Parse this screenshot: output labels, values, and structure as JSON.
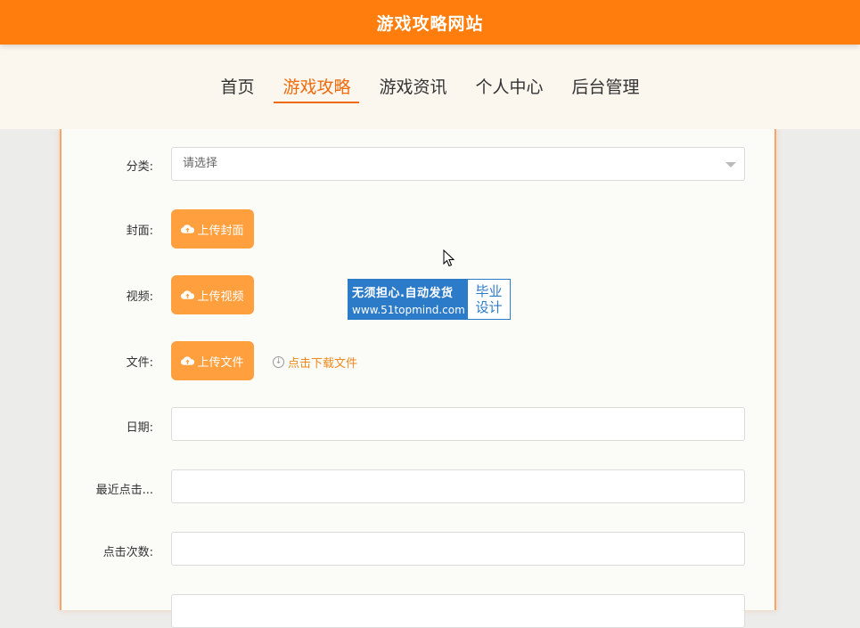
{
  "header": {
    "site_title": "游戏攻略网站"
  },
  "nav": {
    "items": [
      {
        "label": "首页",
        "active": false
      },
      {
        "label": "游戏攻略",
        "active": true
      },
      {
        "label": "游戏资讯",
        "active": false
      },
      {
        "label": "个人中心",
        "active": false
      },
      {
        "label": "后台管理",
        "active": false
      }
    ]
  },
  "form": {
    "category": {
      "label": "分类:",
      "placeholder": "请选择"
    },
    "cover": {
      "label": "封面:",
      "button": "上传封面"
    },
    "video": {
      "label": "视频:",
      "button": "上传视频"
    },
    "file": {
      "label": "文件:",
      "button": "上传文件",
      "download": "点击下载文件"
    },
    "date": {
      "label": "日期:",
      "value": ""
    },
    "last_click": {
      "label": "最近点击...",
      "value": ""
    },
    "click_count": {
      "label": "点击次数:",
      "value": ""
    }
  },
  "watermark": {
    "line1": "无须担心.自动发货",
    "line2": "www.51topmind.com",
    "badge_top": "毕业",
    "badge_bottom": "设计"
  },
  "colors": {
    "primary": "#ff7d0c",
    "button": "#ff9f3e",
    "accent": "#f06a0b"
  },
  "icons": {
    "upload": "cloud-upload-icon",
    "download": "download-circle-icon",
    "select": "chevron-down-icon"
  }
}
